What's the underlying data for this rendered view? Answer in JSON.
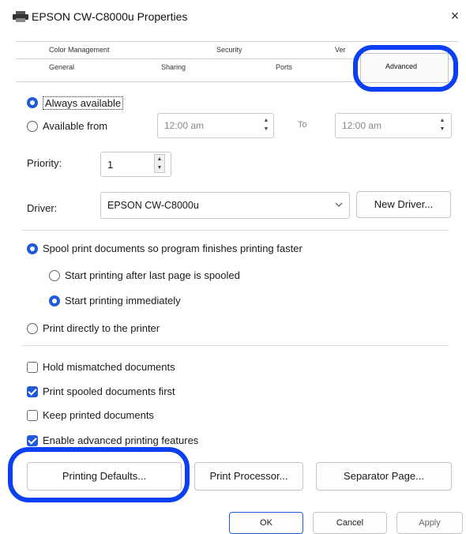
{
  "window": {
    "title": "EPSON CW-C8000u Properties",
    "close_glyph": "×"
  },
  "tabs": {
    "row1": [
      "Color Management",
      "Security",
      "Version Information"
    ],
    "row2": [
      "General",
      "Sharing",
      "Ports",
      "Advanced"
    ],
    "version_visible": "Ver"
  },
  "availability": {
    "always_label": "Always available",
    "from_label": "Available from",
    "from_time": "12:00 am",
    "to_label": "To",
    "to_time": "12:00 am",
    "selected": "always"
  },
  "priority": {
    "label": "Priority:",
    "value": "1"
  },
  "driver": {
    "label": "Driver:",
    "value": "EPSON CW-C8000u",
    "new_driver_button": "New Driver..."
  },
  "spool": {
    "spool_label": "Spool print documents so program finishes printing faster",
    "after_last_label": "Start printing after last page is spooled",
    "immediately_label": "Start printing immediately",
    "direct_label": "Print directly to the printer"
  },
  "options": {
    "hold_mismatched": {
      "label": "Hold mismatched documents",
      "checked": false
    },
    "print_spooled_first": {
      "label": "Print spooled documents first",
      "checked": true
    },
    "keep_printed": {
      "label": "Keep printed documents",
      "checked": false
    },
    "enable_advanced": {
      "label": "Enable advanced printing features",
      "checked": true
    }
  },
  "buttons": {
    "printing_defaults": "Printing Defaults...",
    "print_processor": "Print Processor...",
    "separator_page": "Separator Page...",
    "ok": "OK",
    "cancel": "Cancel",
    "apply": "Apply"
  },
  "colors": {
    "accent": "#1f5bd8",
    "annotation": "#0a3ff2"
  },
  "icons": {
    "title_icon": "printer-icon",
    "dropdown": "chevron-down-icon"
  }
}
